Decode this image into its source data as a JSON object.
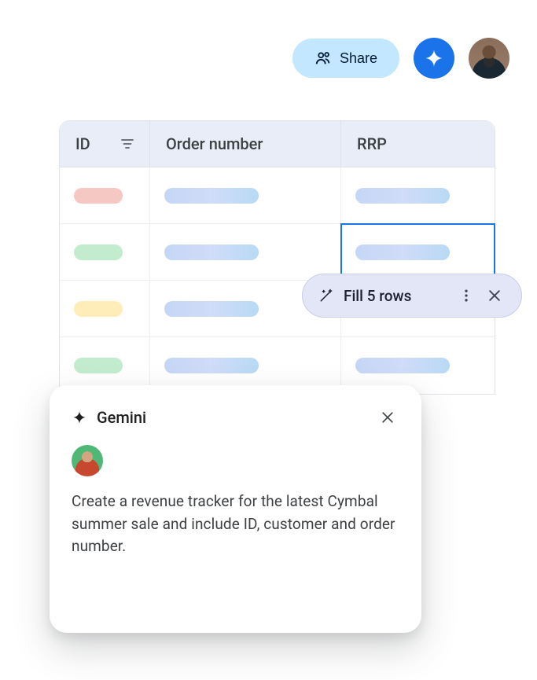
{
  "topbar": {
    "share_label": "Share"
  },
  "table": {
    "columns": {
      "id": "ID",
      "order": "Order number",
      "rrp": "RRP"
    },
    "rows": [
      {
        "id_color": "solid-red",
        "has_order": true,
        "has_rrp": true,
        "selected": false
      },
      {
        "id_color": "solid-green",
        "has_order": true,
        "has_rrp": true,
        "selected": true
      },
      {
        "id_color": "solid-yellow",
        "has_order": true,
        "has_rrp": true,
        "selected": false
      },
      {
        "id_color": "solid-green",
        "has_order": true,
        "has_rrp": true,
        "selected": false
      }
    ]
  },
  "fill": {
    "label": "Fill 5 rows"
  },
  "gemini": {
    "title": "Gemini",
    "prompt": "Create a revenue tracker for the latest Cymbal summer sale and include ID, customer and order number."
  }
}
